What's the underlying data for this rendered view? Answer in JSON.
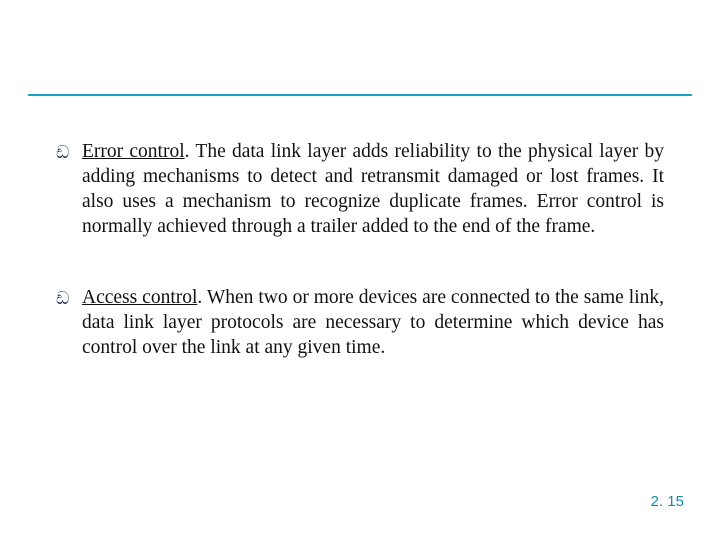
{
  "bullets": [
    {
      "lead": "Error control",
      "body": ". The data link layer adds reliability to the physical layer by adding mechanisms to detect and retransmit damaged or lost frames. It also uses a mechanism to recognize duplicate frames. Error control is normally achieved through a trailer added to the end of the frame."
    },
    {
      "lead": "Access control",
      "body": ". When two or more devices are connected to the same link, data link layer protocols are necessary to determine which device has control over the link at any given time."
    }
  ],
  "glyphs": {
    "bullet": "ඩ"
  },
  "page_number": "2. 15",
  "colors": {
    "rule": "#1ea0c9",
    "bullet_color": "#0a2a5c",
    "pagenum_color": "#1a87a8"
  }
}
